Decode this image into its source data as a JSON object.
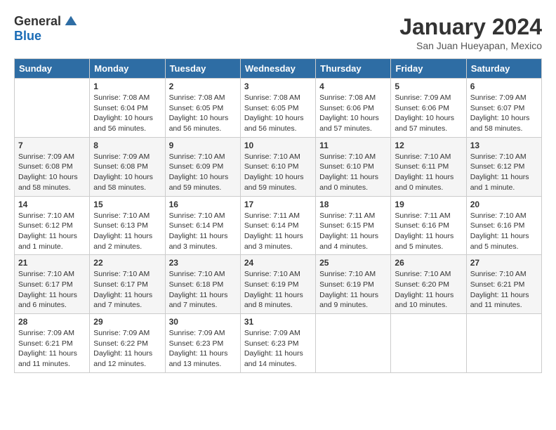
{
  "header": {
    "logo_general": "General",
    "logo_blue": "Blue",
    "month_title": "January 2024",
    "location": "San Juan Hueyapan, Mexico"
  },
  "weekdays": [
    "Sunday",
    "Monday",
    "Tuesday",
    "Wednesday",
    "Thursday",
    "Friday",
    "Saturday"
  ],
  "weeks": [
    [
      {
        "day": "",
        "sunrise": "",
        "sunset": "",
        "daylight": ""
      },
      {
        "day": "1",
        "sunrise": "Sunrise: 7:08 AM",
        "sunset": "Sunset: 6:04 PM",
        "daylight": "Daylight: 10 hours and 56 minutes."
      },
      {
        "day": "2",
        "sunrise": "Sunrise: 7:08 AM",
        "sunset": "Sunset: 6:05 PM",
        "daylight": "Daylight: 10 hours and 56 minutes."
      },
      {
        "day": "3",
        "sunrise": "Sunrise: 7:08 AM",
        "sunset": "Sunset: 6:05 PM",
        "daylight": "Daylight: 10 hours and 56 minutes."
      },
      {
        "day": "4",
        "sunrise": "Sunrise: 7:08 AM",
        "sunset": "Sunset: 6:06 PM",
        "daylight": "Daylight: 10 hours and 57 minutes."
      },
      {
        "day": "5",
        "sunrise": "Sunrise: 7:09 AM",
        "sunset": "Sunset: 6:06 PM",
        "daylight": "Daylight: 10 hours and 57 minutes."
      },
      {
        "day": "6",
        "sunrise": "Sunrise: 7:09 AM",
        "sunset": "Sunset: 6:07 PM",
        "daylight": "Daylight: 10 hours and 58 minutes."
      }
    ],
    [
      {
        "day": "7",
        "sunrise": "Sunrise: 7:09 AM",
        "sunset": "Sunset: 6:08 PM",
        "daylight": "Daylight: 10 hours and 58 minutes."
      },
      {
        "day": "8",
        "sunrise": "Sunrise: 7:09 AM",
        "sunset": "Sunset: 6:08 PM",
        "daylight": "Daylight: 10 hours and 58 minutes."
      },
      {
        "day": "9",
        "sunrise": "Sunrise: 7:10 AM",
        "sunset": "Sunset: 6:09 PM",
        "daylight": "Daylight: 10 hours and 59 minutes."
      },
      {
        "day": "10",
        "sunrise": "Sunrise: 7:10 AM",
        "sunset": "Sunset: 6:10 PM",
        "daylight": "Daylight: 10 hours and 59 minutes."
      },
      {
        "day": "11",
        "sunrise": "Sunrise: 7:10 AM",
        "sunset": "Sunset: 6:10 PM",
        "daylight": "Daylight: 11 hours and 0 minutes."
      },
      {
        "day": "12",
        "sunrise": "Sunrise: 7:10 AM",
        "sunset": "Sunset: 6:11 PM",
        "daylight": "Daylight: 11 hours and 0 minutes."
      },
      {
        "day": "13",
        "sunrise": "Sunrise: 7:10 AM",
        "sunset": "Sunset: 6:12 PM",
        "daylight": "Daylight: 11 hours and 1 minute."
      }
    ],
    [
      {
        "day": "14",
        "sunrise": "Sunrise: 7:10 AM",
        "sunset": "Sunset: 6:12 PM",
        "daylight": "Daylight: 11 hours and 1 minute."
      },
      {
        "day": "15",
        "sunrise": "Sunrise: 7:10 AM",
        "sunset": "Sunset: 6:13 PM",
        "daylight": "Daylight: 11 hours and 2 minutes."
      },
      {
        "day": "16",
        "sunrise": "Sunrise: 7:10 AM",
        "sunset": "Sunset: 6:14 PM",
        "daylight": "Daylight: 11 hours and 3 minutes."
      },
      {
        "day": "17",
        "sunrise": "Sunrise: 7:11 AM",
        "sunset": "Sunset: 6:14 PM",
        "daylight": "Daylight: 11 hours and 3 minutes."
      },
      {
        "day": "18",
        "sunrise": "Sunrise: 7:11 AM",
        "sunset": "Sunset: 6:15 PM",
        "daylight": "Daylight: 11 hours and 4 minutes."
      },
      {
        "day": "19",
        "sunrise": "Sunrise: 7:11 AM",
        "sunset": "Sunset: 6:16 PM",
        "daylight": "Daylight: 11 hours and 5 minutes."
      },
      {
        "day": "20",
        "sunrise": "Sunrise: 7:10 AM",
        "sunset": "Sunset: 6:16 PM",
        "daylight": "Daylight: 11 hours and 5 minutes."
      }
    ],
    [
      {
        "day": "21",
        "sunrise": "Sunrise: 7:10 AM",
        "sunset": "Sunset: 6:17 PM",
        "daylight": "Daylight: 11 hours and 6 minutes."
      },
      {
        "day": "22",
        "sunrise": "Sunrise: 7:10 AM",
        "sunset": "Sunset: 6:17 PM",
        "daylight": "Daylight: 11 hours and 7 minutes."
      },
      {
        "day": "23",
        "sunrise": "Sunrise: 7:10 AM",
        "sunset": "Sunset: 6:18 PM",
        "daylight": "Daylight: 11 hours and 7 minutes."
      },
      {
        "day": "24",
        "sunrise": "Sunrise: 7:10 AM",
        "sunset": "Sunset: 6:19 PM",
        "daylight": "Daylight: 11 hours and 8 minutes."
      },
      {
        "day": "25",
        "sunrise": "Sunrise: 7:10 AM",
        "sunset": "Sunset: 6:19 PM",
        "daylight": "Daylight: 11 hours and 9 minutes."
      },
      {
        "day": "26",
        "sunrise": "Sunrise: 7:10 AM",
        "sunset": "Sunset: 6:20 PM",
        "daylight": "Daylight: 11 hours and 10 minutes."
      },
      {
        "day": "27",
        "sunrise": "Sunrise: 7:10 AM",
        "sunset": "Sunset: 6:21 PM",
        "daylight": "Daylight: 11 hours and 11 minutes."
      }
    ],
    [
      {
        "day": "28",
        "sunrise": "Sunrise: 7:09 AM",
        "sunset": "Sunset: 6:21 PM",
        "daylight": "Daylight: 11 hours and 11 minutes."
      },
      {
        "day": "29",
        "sunrise": "Sunrise: 7:09 AM",
        "sunset": "Sunset: 6:22 PM",
        "daylight": "Daylight: 11 hours and 12 minutes."
      },
      {
        "day": "30",
        "sunrise": "Sunrise: 7:09 AM",
        "sunset": "Sunset: 6:23 PM",
        "daylight": "Daylight: 11 hours and 13 minutes."
      },
      {
        "day": "31",
        "sunrise": "Sunrise: 7:09 AM",
        "sunset": "Sunset: 6:23 PM",
        "daylight": "Daylight: 11 hours and 14 minutes."
      },
      {
        "day": "",
        "sunrise": "",
        "sunset": "",
        "daylight": ""
      },
      {
        "day": "",
        "sunrise": "",
        "sunset": "",
        "daylight": ""
      },
      {
        "day": "",
        "sunrise": "",
        "sunset": "",
        "daylight": ""
      }
    ]
  ]
}
